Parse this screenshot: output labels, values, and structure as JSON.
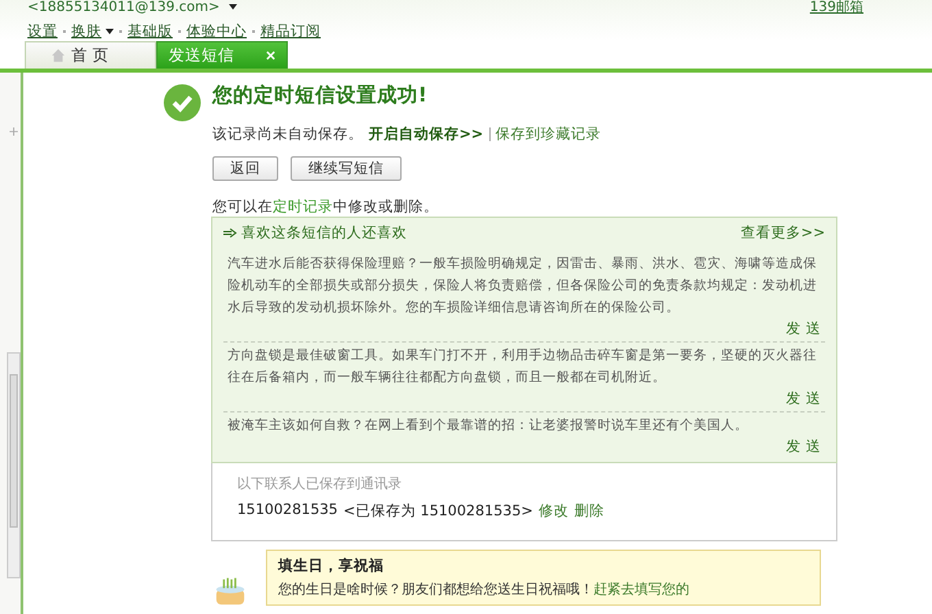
{
  "header": {
    "account": "<18855134011@139.com>",
    "mailbox_link": "139邮箱",
    "nav": [
      {
        "label": "设置",
        "dropdown": false
      },
      {
        "label": "换肤",
        "dropdown": true
      },
      {
        "label": "基础版",
        "dropdown": false
      },
      {
        "label": "体验中心",
        "dropdown": false
      },
      {
        "label": "精品订阅",
        "dropdown": false
      }
    ]
  },
  "tabs": [
    {
      "label": "首 页",
      "selected": false,
      "closable": false
    },
    {
      "label": "发送短信",
      "selected": true,
      "closable": true
    }
  ],
  "success": {
    "title": "您的定时短信设置成功!",
    "notice": "该记录尚未自动保存。",
    "auto_save_link": "开启自动保存>>",
    "favorite_link": "保存到珍藏记录"
  },
  "buttons": [
    "返回",
    "继续写短信"
  ],
  "hint": {
    "before": "您可以在",
    "link": "定时记录",
    "after": "中修改或删除。"
  },
  "recommend": {
    "title": "喜欢这条短信的人还喜欢",
    "more": "查看更多>>",
    "items": [
      {
        "text": "汽车进水后能否获得保险理赔？一般车损险明确规定，因雷击、暴雨、洪水、雹灾、海啸等造成保险机动车的全部损失或部分损失，保险人将负责赔偿，但各保险公司的免责条款均规定：发动机进水后导致的发动机损坏除外。您的车损险详细信息请咨询所在的保险公司。",
        "send": "发 送"
      },
      {
        "text": "方向盘锁是最佳破窗工具。如果车门打不开，利用手边物品击碎车窗是第一要务，坚硬的灭火器往往在后备箱内，而一般车辆往往都配方向盘锁，而且一般都在司机附近。",
        "send": "发 送"
      },
      {
        "text": "被淹车主该如何自救？在网上看到个最靠谱的招：让老婆报警时说车里还有个美国人。",
        "send": "发 送"
      }
    ]
  },
  "contacts": {
    "caption": "以下联系人已保存到通讯录",
    "entries": [
      {
        "number": "15100281535",
        "saved_as": "<已保存为 15100281535>",
        "edit": "修改",
        "delete": "删除"
      }
    ]
  },
  "birthday": {
    "title": "填生日，享祝福",
    "text": "您的生日是啥时候？朋友们都想给您送生日祝福哦！",
    "link": "赶紧去填写您的"
  }
}
